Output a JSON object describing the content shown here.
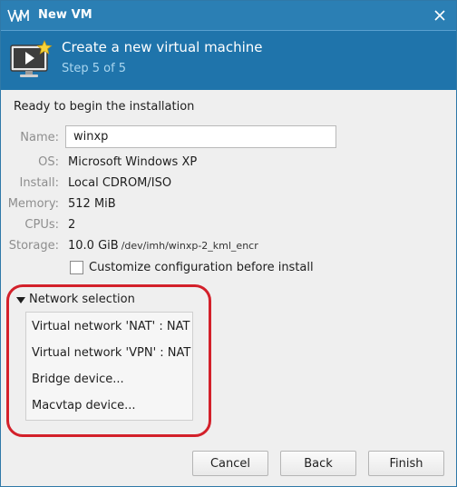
{
  "window": {
    "title": "New VM",
    "close_glyph": "✕"
  },
  "header": {
    "title": "Create a new virtual machine",
    "step": "Step 5 of 5",
    "icon": "monitor-play-star-icon"
  },
  "summary": {
    "intro": "Ready to begin the installation",
    "name_label": "Name:",
    "name_value": "winxp",
    "os_label": "OS:",
    "os_value": "Microsoft Windows XP",
    "install_label": "Install:",
    "install_value": "Local CDROM/ISO",
    "memory_label": "Memory:",
    "memory_value": "512 MiB",
    "cpus_label": "CPUs:",
    "cpus_value": "2",
    "storage_label": "Storage:",
    "storage_size": "10.0 GiB",
    "storage_path": "/dev/imh/winxp-2_kml_encr",
    "customize_label": "Customize configuration before install",
    "customize_checked": false
  },
  "network": {
    "expander_label": "Network selection",
    "expanded": true,
    "options": [
      "Virtual network 'NAT' : NAT",
      "Virtual network 'VPN' : NAT",
      "Bridge device...",
      "Macvtap device..."
    ]
  },
  "buttons": {
    "cancel": "Cancel",
    "back": "Back",
    "finish": "Finish"
  },
  "colors": {
    "titlebar": "#2b7fb4",
    "header": "#1f74ab",
    "highlight": "#d3202a"
  }
}
